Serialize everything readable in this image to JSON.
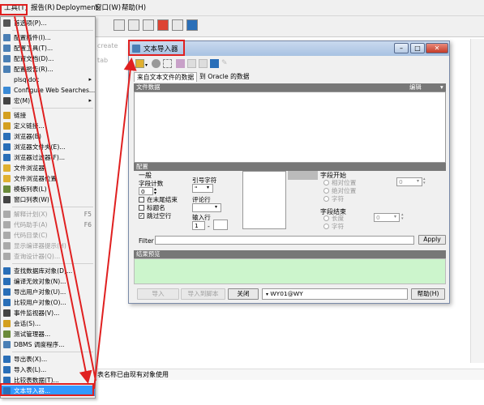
{
  "menubar": {
    "items": [
      "工具(T)",
      "报告(R)",
      "Deployment",
      "窗口(W)",
      "帮助(H)"
    ]
  },
  "background": {
    "tab_label": "create tab",
    "status_text": "表名称已由现有对象使用"
  },
  "tools_menu": {
    "items": [
      {
        "label": "首选项(P)...",
        "icon": "wrench-icon",
        "color": "#555555"
      },
      {
        "sep": true
      },
      {
        "label": "配置插件(I)...",
        "icon": "plugin-icon",
        "color": "#4a7fb5"
      },
      {
        "label": "配置工具(T)...",
        "icon": "tools-icon",
        "color": "#4a7fb5"
      },
      {
        "label": "配置文档(D)...",
        "icon": "document-icon",
        "color": "#4a7fb5"
      },
      {
        "label": "配置报告(R)...",
        "icon": "report-icon",
        "color": "#4a7fb5"
      },
      {
        "label": "plsqldoc",
        "icon": "",
        "arrow": "▸"
      },
      {
        "label": "Configure Web Searches...",
        "icon": "web-search-icon",
        "color": "#3a8ad6"
      },
      {
        "label": "宏(M)",
        "icon": "macro-icon",
        "color": "#444444",
        "arrow": "▸"
      },
      {
        "sep": true
      },
      {
        "label": "链接",
        "icon": "link-icon",
        "color": "#d4a020"
      },
      {
        "label": "定义链接...",
        "icon": "define-link-icon",
        "color": "#d4a020"
      },
      {
        "label": "浏览器(B)",
        "icon": "browser-icon",
        "color": "#2a6fb8"
      },
      {
        "label": "浏览器文件夹(E)...",
        "icon": "folder-icon",
        "color": "#2a6fb8"
      },
      {
        "label": "浏览器过滤器(F)...",
        "icon": "filter-icon",
        "color": "#2a6fb8"
      },
      {
        "label": "文件浏览器",
        "icon": "file-browser-icon",
        "color": "#e0b030"
      },
      {
        "label": "文件浏览器位置",
        "icon": "file-location-icon",
        "color": "#e0b030"
      },
      {
        "label": "模板列表(L)",
        "icon": "template-icon",
        "color": "#6a8a3a"
      },
      {
        "label": "窗口列表(W)",
        "icon": "window-list-icon",
        "color": "#444444"
      },
      {
        "sep": true
      },
      {
        "label": "解释计划(X)",
        "icon": "explain-icon",
        "color": "#aaaaaa",
        "shortcut": "F5",
        "disabled": true
      },
      {
        "label": "代码助手(A)",
        "icon": "assistant-icon",
        "color": "#aaaaaa",
        "shortcut": "F6",
        "disabled": true
      },
      {
        "label": "代码目录(C)",
        "icon": "code-dir-icon",
        "color": "#aaaaaa",
        "disabled": true
      },
      {
        "label": "显示编译器提示(H)",
        "icon": "hint-icon",
        "color": "#aaaaaa",
        "disabled": true
      },
      {
        "label": "查询设计器(Q)...",
        "icon": "query-icon",
        "color": "#aaaaaa",
        "disabled": true
      },
      {
        "sep": true
      },
      {
        "label": "查找数据库对象(D)...",
        "icon": "find-db-icon",
        "color": "#2a6fb8"
      },
      {
        "label": "编译无效对象(N)...",
        "icon": "compile-icon",
        "color": "#2a6fb8"
      },
      {
        "label": "导出用户对象(U)...",
        "icon": "export-user-icon",
        "color": "#2a6fb8"
      },
      {
        "label": "比较用户对象(O)...",
        "icon": "compare-user-icon",
        "color": "#2a6fb8"
      },
      {
        "label": "事件监视器(V)...",
        "icon": "monitor-icon",
        "color": "#444444"
      },
      {
        "label": "会话(S)...",
        "icon": "session-icon",
        "color": "#d4a020"
      },
      {
        "label": "测试管理器...",
        "icon": "test-icon",
        "color": "#6a8a3a"
      },
      {
        "label": "DBMS 调度程序...",
        "icon": "scheduler-icon",
        "color": "#4a7fb5"
      },
      {
        "sep": true
      },
      {
        "label": "导出表(X)...",
        "icon": "export-table-icon",
        "color": "#2a6fb8"
      },
      {
        "label": "导入表(L)...",
        "icon": "import-table-icon",
        "color": "#2a6fb8"
      },
      {
        "label": "比较表数据(T)...",
        "icon": "compare-table-icon",
        "color": "#2a6fb8"
      },
      {
        "label": "文本导入器...",
        "icon": "text-import-icon",
        "color": "#2a6fb8",
        "highlight": true
      }
    ]
  },
  "dialog": {
    "title": "文本导入器",
    "tabs": [
      "来自文本文件的数据",
      "到 Oracle 的数据"
    ],
    "file_data_header": "文件数据",
    "edit_label": "编辑",
    "config_header": "配置",
    "general_title": "一般",
    "field_count_label": "字段计数",
    "field_count_value": "0",
    "at_end_label": "在末尾结束",
    "header_name_label": "标题名",
    "skip_empty_label": "跳过空行",
    "quote_label": "引号字符",
    "quote_value": "\"",
    "comment_label": "评论行",
    "import_lines_label": "输入行",
    "import_from_value": "1",
    "field_start_title": "字段开始",
    "relative_pos_label": "相对位置",
    "absolute_pos_label": "绝对位置",
    "char_label": "字符",
    "field_end_title": "字段结束",
    "length_label": "长度",
    "pos_value_1": "0",
    "pos_value_2": "0",
    "filter_label": "Filter",
    "apply_label": "Apply",
    "result_header": "结果预览",
    "import_btn": "导入",
    "import_script_btn": "导入到脚本",
    "close_btn": "关闭",
    "connection": "WY01@WY",
    "help_btn": "帮助(H)"
  }
}
